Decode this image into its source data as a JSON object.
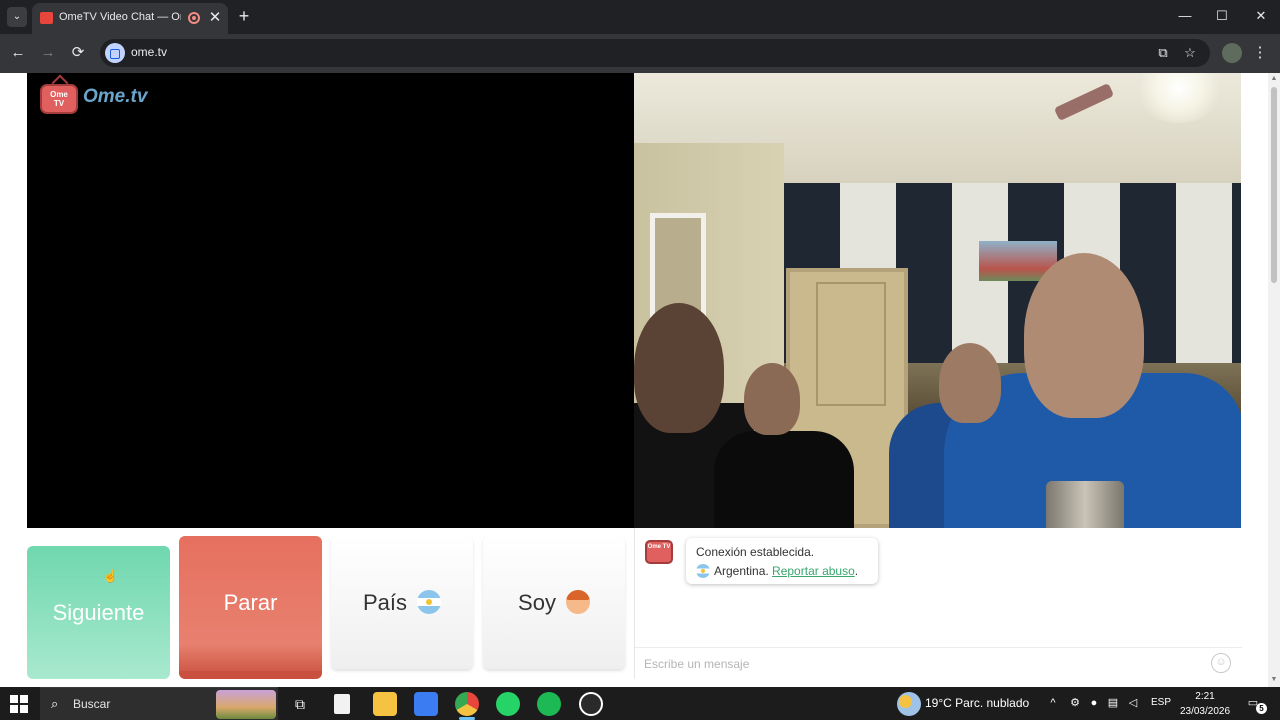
{
  "browser": {
    "tab_title": "OmeTV Video Chat — Ome",
    "tab_close": "✕",
    "new_tab": "+",
    "tab_list": "⌄",
    "url": "ome.tv",
    "window": {
      "minimize": "—",
      "maximize": "☐",
      "close": "✕"
    },
    "nav": {
      "back": "←",
      "forward": "→",
      "reload": "⟳"
    },
    "omnibox_icons": {
      "install": "⧉",
      "bookmark": "☆"
    },
    "menu": "⋮"
  },
  "page": {
    "logo_tv": "Ome TV",
    "logo_text": "Ome.tv",
    "buttons": {
      "next": "Siguiente",
      "stop": "Parar",
      "country": "País",
      "soy": "Soy"
    },
    "chat": {
      "avatar_text": "Ome TV",
      "message_line1": "Conexión establecida.",
      "country": "Argentina.",
      "report_link": "Reportar abuso",
      "report_suffix": ".",
      "input_placeholder": "Escribe un mensaje",
      "emoji": "☺"
    }
  },
  "taskbar": {
    "search_placeholder": "Buscar",
    "weather": "19°C  Parc. nublado",
    "language": "ESP",
    "time": "2:21",
    "date": "23/03/2026",
    "notifications": "5",
    "apps": [
      "task-view",
      "file-explorer-doc",
      "file-explorer",
      "store",
      "chrome",
      "whatsapp",
      "spotify",
      "obs"
    ],
    "colors": {
      "chrome": "#e8453c",
      "whatsapp": "#25d366",
      "spotify": "#1db954",
      "explorer": "#f5c242",
      "store": "#3c7cf2"
    }
  }
}
